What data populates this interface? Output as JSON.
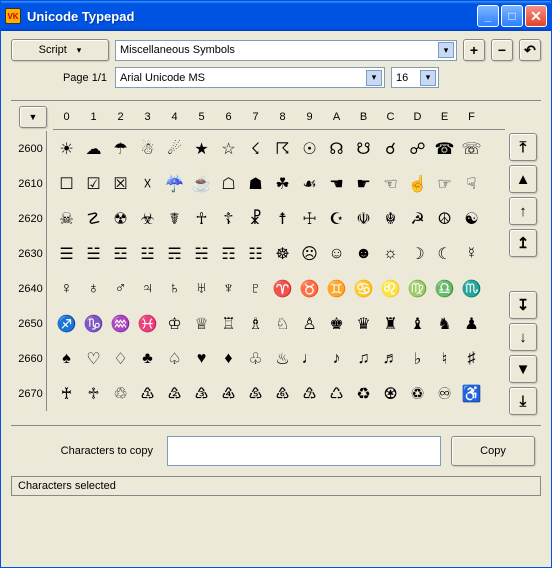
{
  "window": {
    "title": "Unicode Typepad"
  },
  "toolbar": {
    "script_btn": "Script",
    "script_combo": "Miscellaneous Symbols",
    "plus": "+",
    "minus": "−",
    "undo": "↶",
    "page_label": "Page 1/1",
    "font_combo": "Arial Unicode MS",
    "size_combo": "16"
  },
  "grid": {
    "corner": "▼",
    "columns": [
      "0",
      "1",
      "2",
      "3",
      "4",
      "5",
      "6",
      "7",
      "8",
      "9",
      "A",
      "B",
      "C",
      "D",
      "E",
      "F"
    ],
    "rows": [
      {
        "label": "2600",
        "cells": [
          "☀",
          "☁",
          "☂",
          "☃",
          "☄",
          "★",
          "☆",
          "☇",
          "☈",
          "☉",
          "☊",
          "☋",
          "☌",
          "☍",
          "☎",
          "☏"
        ]
      },
      {
        "label": "2610",
        "cells": [
          "☐",
          "☑",
          "☒",
          "☓",
          "☔",
          "☕",
          "☖",
          "☗",
          "☘",
          "☙",
          "☚",
          "☛",
          "☜",
          "☝",
          "☞",
          "☟"
        ]
      },
      {
        "label": "2620",
        "cells": [
          "☠",
          "☡",
          "☢",
          "☣",
          "☤",
          "☥",
          "☦",
          "☧",
          "☨",
          "☩",
          "☪",
          "☫",
          "☬",
          "☭",
          "☮",
          "☯"
        ]
      },
      {
        "label": "2630",
        "cells": [
          "☰",
          "☱",
          "☲",
          "☳",
          "☴",
          "☵",
          "☶",
          "☷",
          "☸",
          "☹",
          "☺",
          "☻",
          "☼",
          "☽",
          "☾",
          "☿"
        ]
      },
      {
        "label": "2640",
        "cells": [
          "♀",
          "♁",
          "♂",
          "♃",
          "♄",
          "♅",
          "♆",
          "♇",
          "♈",
          "♉",
          "♊",
          "♋",
          "♌",
          "♍",
          "♎",
          "♏"
        ]
      },
      {
        "label": "2650",
        "cells": [
          "♐",
          "♑",
          "♒",
          "♓",
          "♔",
          "♕",
          "♖",
          "♗",
          "♘",
          "♙",
          "♚",
          "♛",
          "♜",
          "♝",
          "♞",
          "♟"
        ]
      },
      {
        "label": "2660",
        "cells": [
          "♠",
          "♡",
          "♢",
          "♣",
          "♤",
          "♥",
          "♦",
          "♧",
          "♨",
          "♩",
          "♪",
          "♫",
          "♬",
          "♭",
          "♮",
          "♯"
        ]
      },
      {
        "label": "2670",
        "cells": [
          "♰",
          "♱",
          "♲",
          "♳",
          "♴",
          "♵",
          "♶",
          "♷",
          "♸",
          "♹",
          "♺",
          "♻",
          "♼",
          "♽",
          "♾",
          "♿"
        ]
      }
    ],
    "scroll": {
      "top": "⤒",
      "pgup": "▲",
      "up": "↑",
      "stepup": "↥",
      "stepdown": "↧",
      "down": "↓",
      "pgdown": "▼",
      "bottom": "⤓"
    }
  },
  "copy": {
    "label": "Characters to copy",
    "value": "",
    "button": "Copy"
  },
  "status": {
    "text": "Characters selected"
  },
  "chart_data": {
    "type": "table",
    "title": "Unicode block Miscellaneous Symbols (U+2600–U+267F)",
    "columns": [
      "0",
      "1",
      "2",
      "3",
      "4",
      "5",
      "6",
      "7",
      "8",
      "9",
      "A",
      "B",
      "C",
      "D",
      "E",
      "F"
    ],
    "row_labels": [
      "2600",
      "2610",
      "2620",
      "2630",
      "2640",
      "2650",
      "2660",
      "2670"
    ],
    "codepoints": [
      [
        "U+2600",
        "U+2601",
        "U+2602",
        "U+2603",
        "U+2604",
        "U+2605",
        "U+2606",
        "U+2607",
        "U+2608",
        "U+2609",
        "U+260A",
        "U+260B",
        "U+260C",
        "U+260D",
        "U+260E",
        "U+260F"
      ],
      [
        "U+2610",
        "U+2611",
        "U+2612",
        "U+2613",
        "U+2614",
        "U+2615",
        "U+2616",
        "U+2617",
        "U+2618",
        "U+2619",
        "U+261A",
        "U+261B",
        "U+261C",
        "U+261D",
        "U+261E",
        "U+261F"
      ],
      [
        "U+2620",
        "U+2621",
        "U+2622",
        "U+2623",
        "U+2624",
        "U+2625",
        "U+2626",
        "U+2627",
        "U+2628",
        "U+2629",
        "U+262A",
        "U+262B",
        "U+262C",
        "U+262D",
        "U+262E",
        "U+262F"
      ],
      [
        "U+2630",
        "U+2631",
        "U+2632",
        "U+2633",
        "U+2634",
        "U+2635",
        "U+2636",
        "U+2637",
        "U+2638",
        "U+2639",
        "U+263A",
        "U+263B",
        "U+263C",
        "U+263D",
        "U+263E",
        "U+263F"
      ],
      [
        "U+2640",
        "U+2641",
        "U+2642",
        "U+2643",
        "U+2644",
        "U+2645",
        "U+2646",
        "U+2647",
        "U+2648",
        "U+2649",
        "U+264A",
        "U+264B",
        "U+264C",
        "U+264D",
        "U+264E",
        "U+264F"
      ],
      [
        "U+2650",
        "U+2651",
        "U+2652",
        "U+2653",
        "U+2654",
        "U+2655",
        "U+2656",
        "U+2657",
        "U+2658",
        "U+2659",
        "U+265A",
        "U+265B",
        "U+265C",
        "U+265D",
        "U+265E",
        "U+265F"
      ],
      [
        "U+2660",
        "U+2661",
        "U+2662",
        "U+2663",
        "U+2664",
        "U+2665",
        "U+2666",
        "U+2667",
        "U+2668",
        "U+2669",
        "U+266A",
        "U+266B",
        "U+266C",
        "U+266D",
        "U+266E",
        "U+266F"
      ],
      [
        "U+2670",
        "U+2671",
        "U+2672",
        "U+2673",
        "U+2674",
        "U+2675",
        "U+2676",
        "U+2677",
        "U+2678",
        "U+2679",
        "U+267A",
        "U+267B",
        "U+267C",
        "U+267D",
        "U+267E",
        "U+267F"
      ]
    ]
  }
}
